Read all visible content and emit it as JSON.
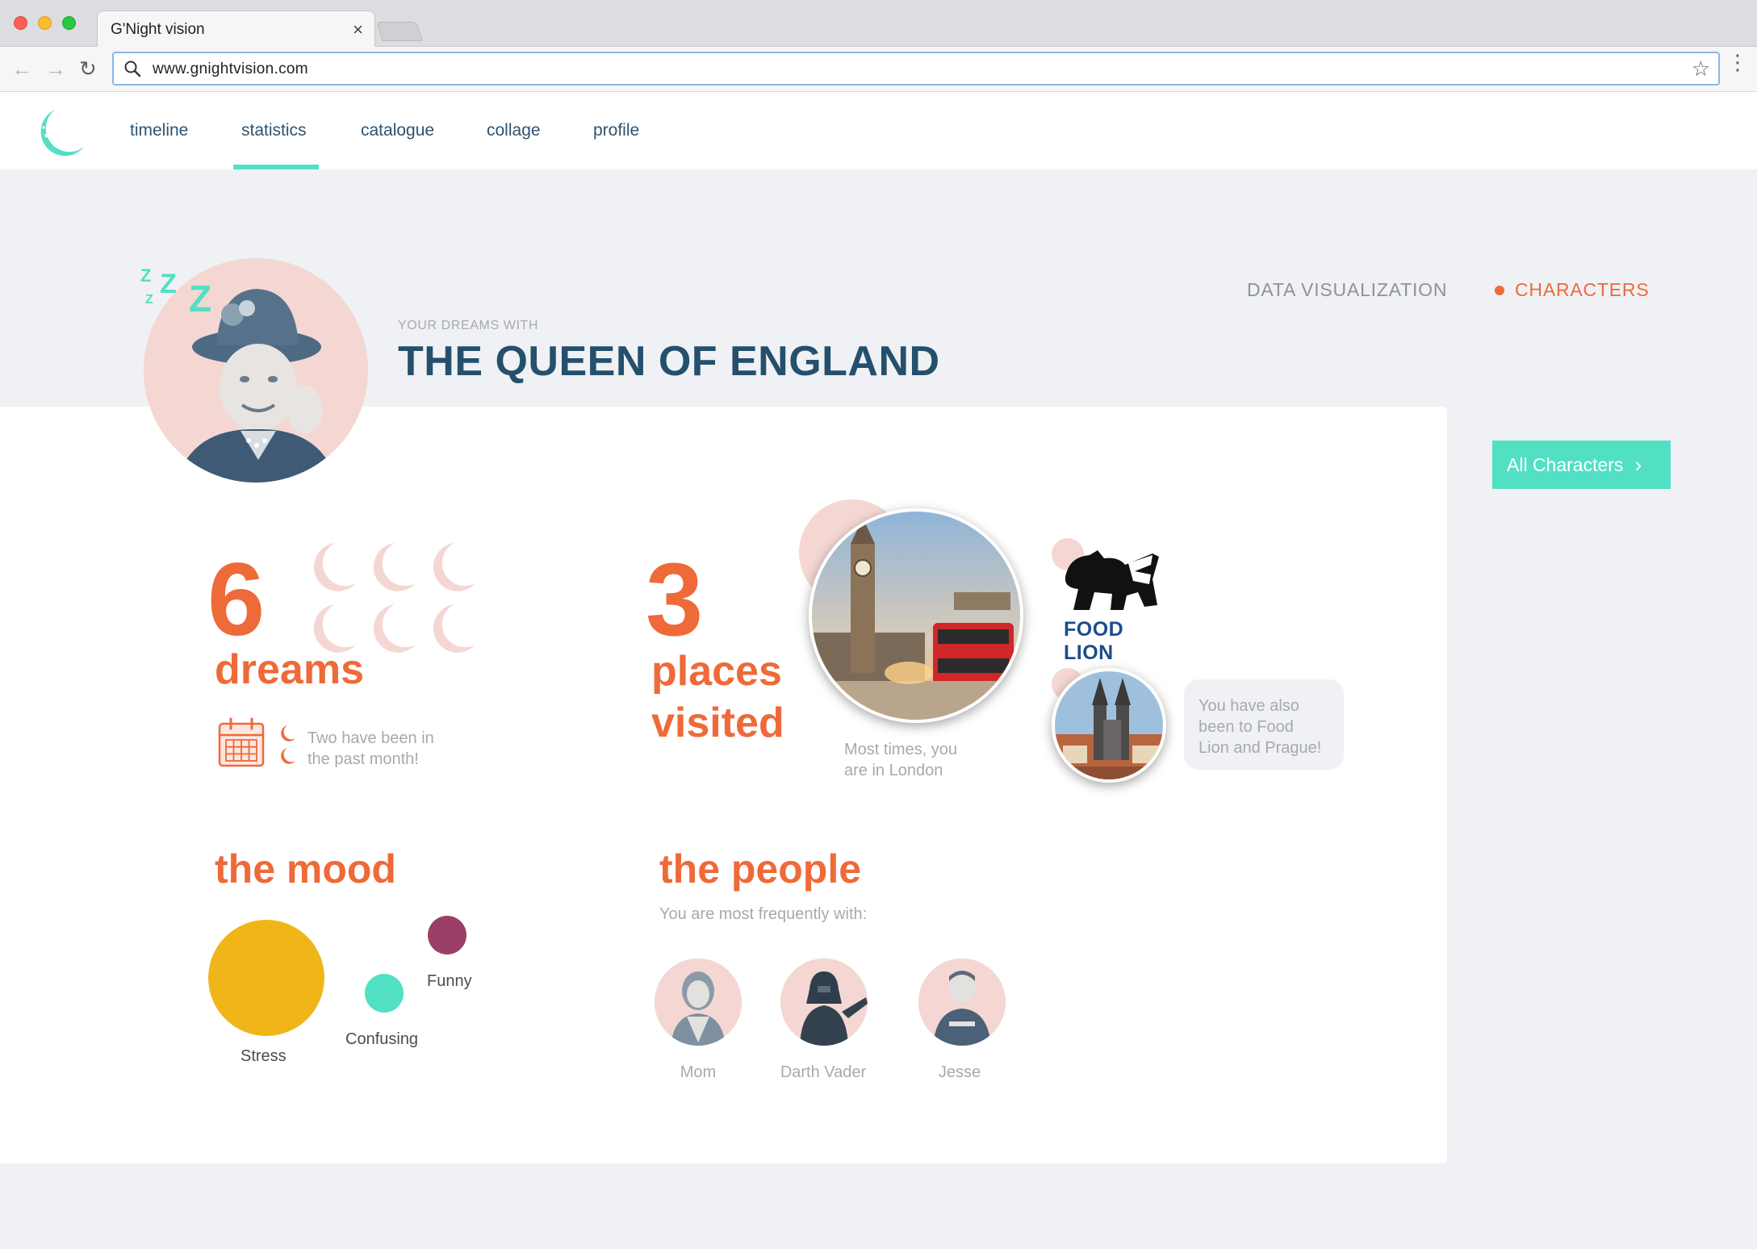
{
  "browser": {
    "tab_title": "G'Night vision",
    "url": "www.gnightvision.com"
  },
  "nav": {
    "items": [
      "timeline",
      "statistics",
      "catalogue",
      "collage",
      "profile"
    ],
    "active": "statistics"
  },
  "header": {
    "eyebrow": "YOUR DREAMS WITH",
    "title": "THE QUEEN OF ENGLAND",
    "zzz": [
      "Z",
      "Z",
      "Z",
      "Z"
    ],
    "view_tabs": {
      "data_visualization": "DATA VISUALIZATION",
      "characters": "CHARACTERS"
    },
    "all_characters_button": "All Characters"
  },
  "dreams": {
    "count": "6",
    "label": "dreams",
    "note_line1": "Two have been in",
    "note_line2": "the past month!",
    "moon_icon_count": 6
  },
  "places": {
    "count": "3",
    "label_line1": "places",
    "label_line2": "visited",
    "note_line1": "Most times, you",
    "note_line2": "are in London",
    "food_lion": "FOOD LION",
    "speech_line1": "You have also",
    "speech_line2": "been to Food",
    "speech_line3": "Lion and Prague!"
  },
  "mood": {
    "title": "the mood",
    "bubbles": [
      {
        "label": "Stress",
        "color": "#f0b619"
      },
      {
        "label": "Confusing",
        "color": "#52e0c4"
      },
      {
        "label": "Funny",
        "color": "#9b3f67"
      }
    ]
  },
  "people": {
    "title": "the people",
    "subtitle": "You are most frequently with:",
    "list": [
      "Mom",
      "Darth Vader",
      "Jesse"
    ]
  },
  "colors": {
    "accent": "#ee6a38",
    "teal": "#52e0c4",
    "navy": "#24506d",
    "pink": "#f4d7d3"
  }
}
